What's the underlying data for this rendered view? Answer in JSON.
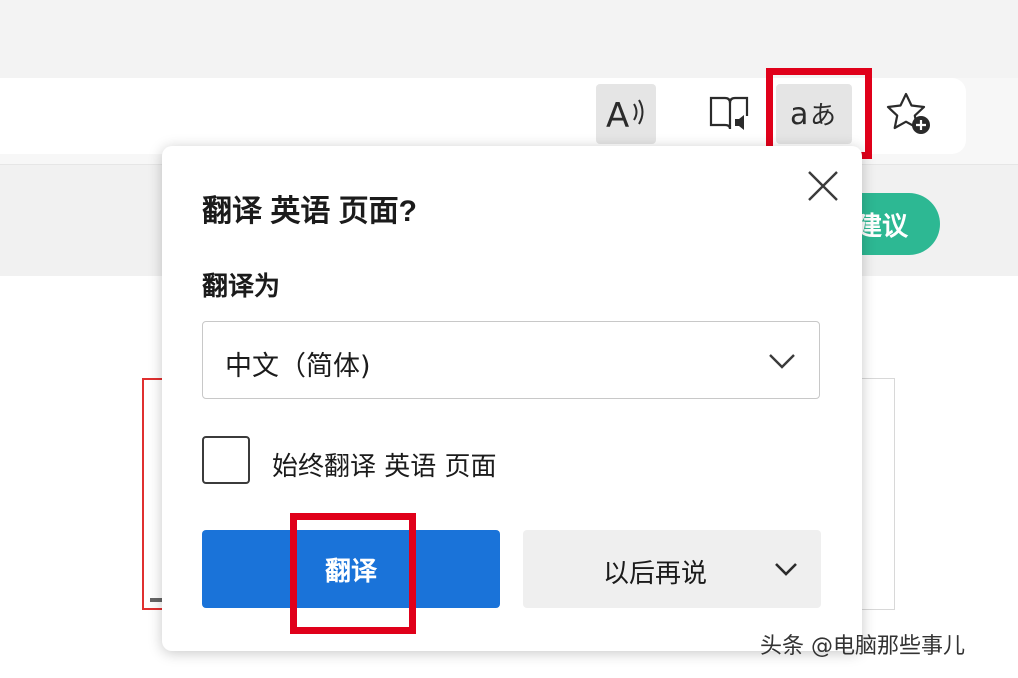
{
  "toolbar": {
    "read_aloud_icon": "read-aloud-icon",
    "immersive_reader_icon": "immersive-reader-icon",
    "translate_icon": "translate-icon",
    "favorites_icon": "add-favorite-icon"
  },
  "page": {
    "green_button_label": "建议"
  },
  "dialog": {
    "title": "翻译 英语 页面?",
    "translate_to_label": "翻译为",
    "language_value": "中文（简体)",
    "always_translate_label": "始终翻译 英语 页面",
    "translate_button": "翻译",
    "later_button": "以后再说"
  },
  "watermark": "头条 @电脑那些事儿",
  "colors": {
    "primary_button": "#1a73d9",
    "highlight": "#e0001a",
    "green_pill": "#2db893"
  }
}
